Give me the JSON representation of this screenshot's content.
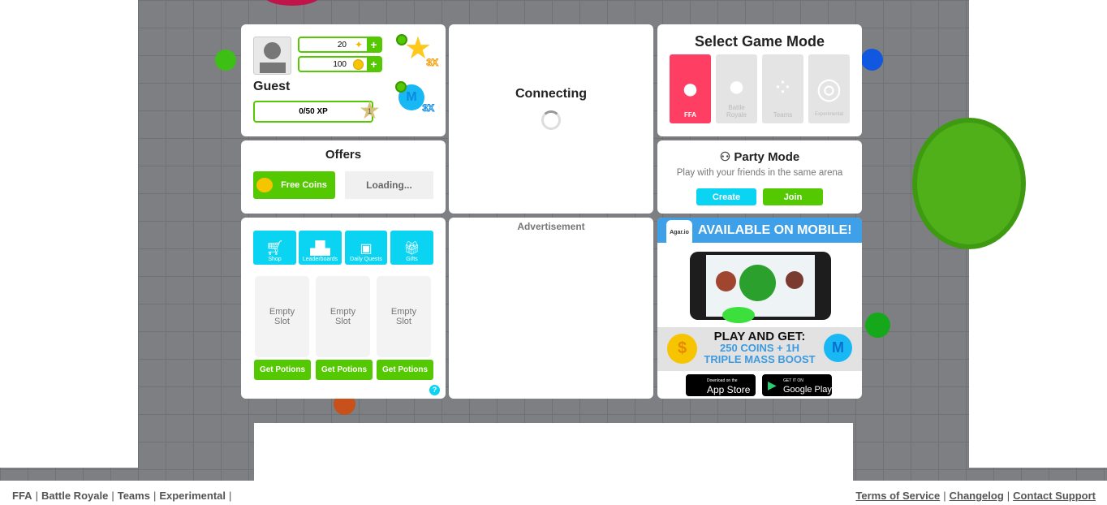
{
  "profile": {
    "name": "Guest",
    "mass_boost_value": "20",
    "coins": "100",
    "xp": "0/50 XP",
    "level": "1",
    "xp_boost": "3X",
    "mass_boost": "3X"
  },
  "offers": {
    "title": "Offers",
    "free_coins": "Free Coins",
    "loading": "Loading..."
  },
  "center": {
    "status": "Connecting",
    "ad_label": "Advertisement"
  },
  "game_mode": {
    "title": "Select Game Mode",
    "modes": [
      {
        "label": "FFA",
        "selected": true
      },
      {
        "label": "Battle Royale"
      },
      {
        "label": "Teams"
      },
      {
        "label": "Experimental"
      }
    ],
    "accent": "#ff3e63"
  },
  "party": {
    "title": "Party Mode",
    "subtitle": "Play with your friends in the same arena",
    "create": "Create",
    "join": "Join"
  },
  "menu": {
    "buttons": [
      {
        "label": "Shop",
        "icon": "cart-icon"
      },
      {
        "label": "Leaderboards",
        "icon": "podium-icon"
      },
      {
        "label": "Daily Quests",
        "icon": "chest-icon"
      },
      {
        "label": "Gifts",
        "icon": "gift-icon"
      }
    ],
    "slots": [
      "Empty Slot",
      "Empty Slot",
      "Empty Slot"
    ],
    "get_potions": "Get Potions",
    "help": "?"
  },
  "promo": {
    "header": "AVAILABLE ON MOBILE!",
    "app_name": "Agar.io",
    "line1": "PLAY AND GET:",
    "line2": "250 COINS + 1H",
    "line3": "TRIPLE MASS BOOST",
    "app_store_small": "Download on the",
    "app_store": "App Store",
    "google_small": "GET IT ON",
    "google": "Google Play"
  },
  "footer": {
    "left": [
      "FFA",
      "Battle Royale",
      "Teams",
      "Experimental"
    ],
    "right": [
      "Terms of Service",
      "Changelog",
      "Contact Support"
    ]
  }
}
